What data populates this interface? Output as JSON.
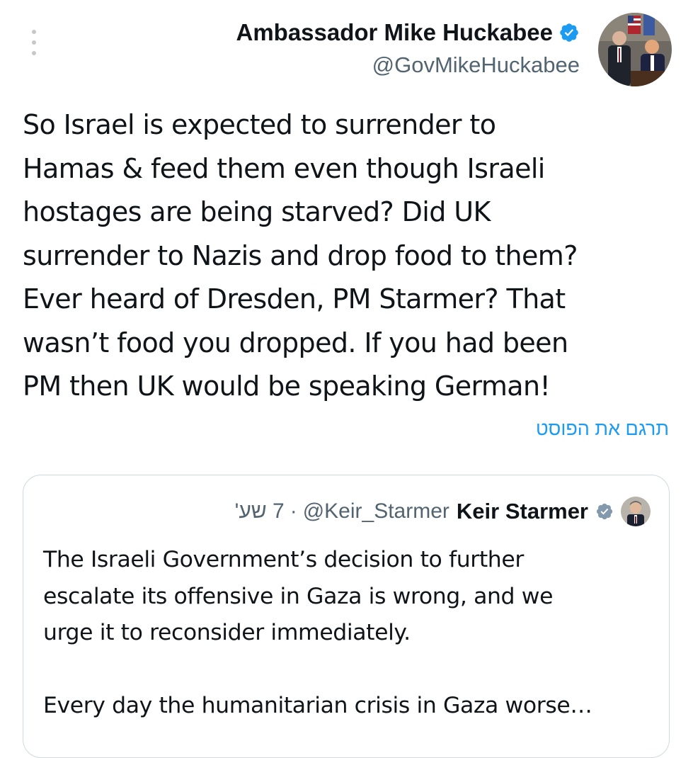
{
  "post": {
    "author_name": "Ambassador Mike Huckabee",
    "author_handle": "@GovMikeHuckabee",
    "text": "So Israel is expected to surrender to\nHamas & feed them even though Israeli\nhostages are being starved?  Did UK\nsurrender to Nazis and drop food to them?\nEver heard of Dresden, PM Starmer?  That\nwasn’t food you dropped. If you had been\nPM then UK would be speaking German!",
    "translate_label": "תרגם את הפוסט",
    "verified_icon": "verified-badge-icon",
    "more_icon": "more-vertical-icon"
  },
  "quoted_post": {
    "author_name": "Keir Starmer",
    "author_handle": "@Keir_Starmer",
    "separator": "·",
    "time": "7 שע'",
    "text": "The Israeli Government’s decision to further\nescalate its offensive in Gaza is wrong, and we\nurge it to reconsider immediately.\n\nEvery day the humanitarian crisis in Gaza worse…",
    "verified_icon": "verified-badge-gray-icon"
  },
  "colors": {
    "text_primary": "#0f1419",
    "text_secondary": "#536471",
    "accent_blue": "#1d9bf0",
    "border": "#cfd9de",
    "verified_gray": "#829aab"
  }
}
